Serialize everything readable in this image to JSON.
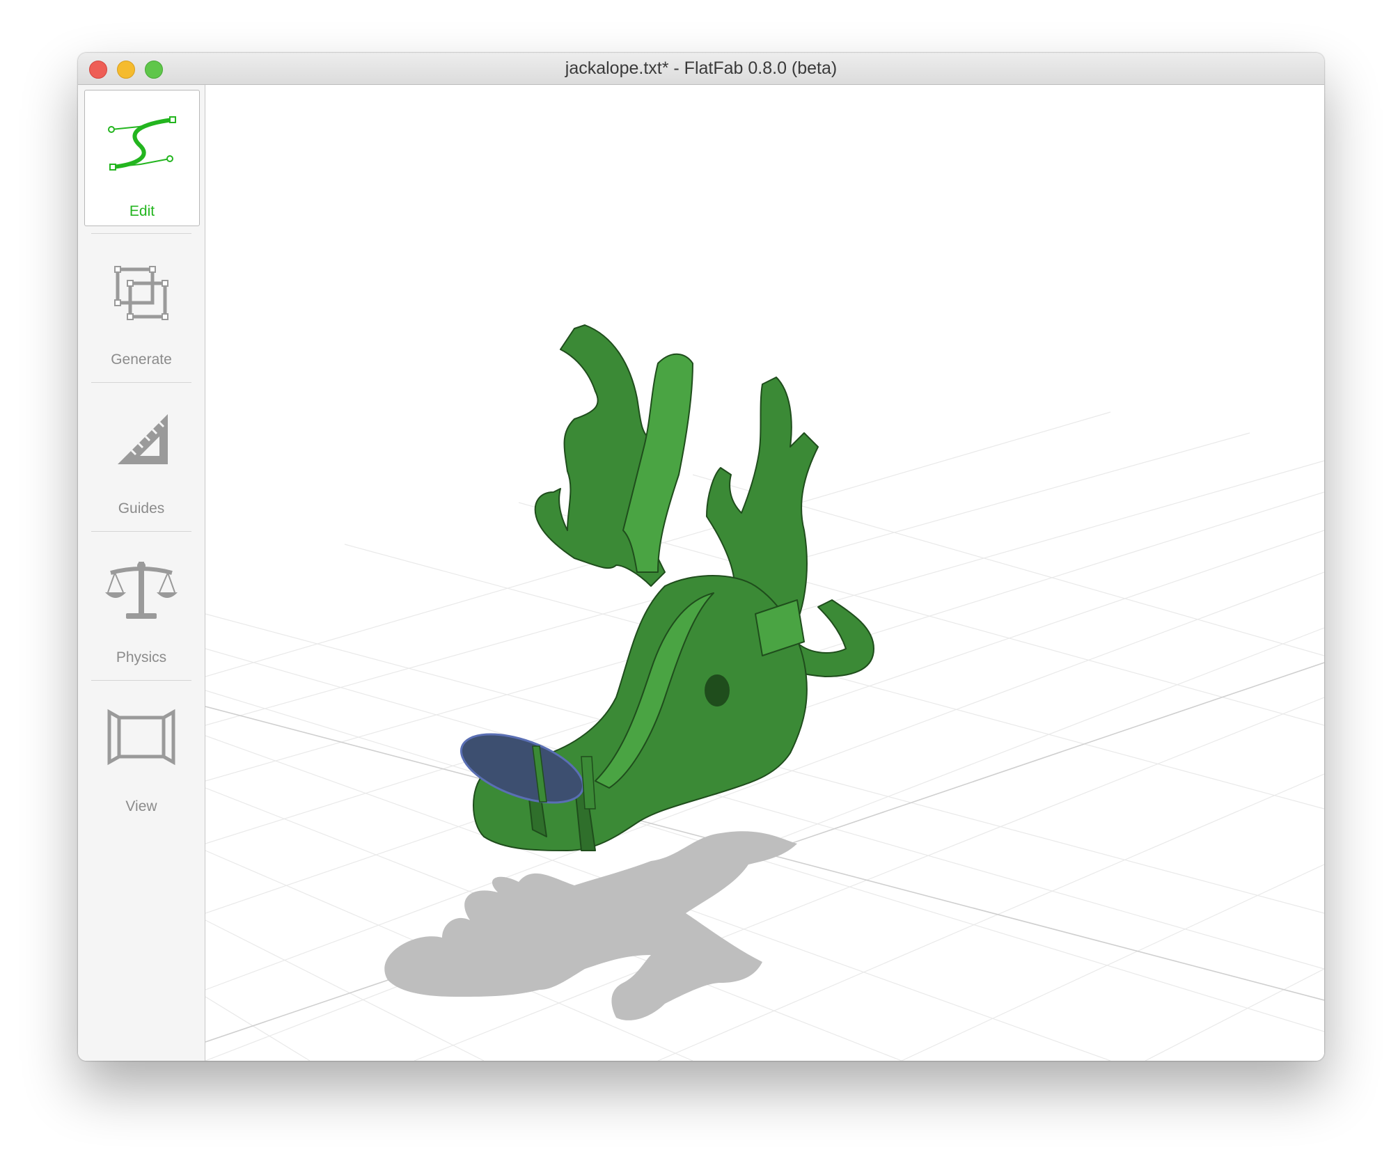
{
  "window": {
    "title": "jackalope.txt* - FlatFab 0.8.0 (beta)"
  },
  "sidebar": {
    "tools": [
      {
        "label": "Edit",
        "icon": "bezier-curve-icon",
        "active": true
      },
      {
        "label": "Generate",
        "icon": "overlapping-squares-icon",
        "active": false
      },
      {
        "label": "Guides",
        "icon": "set-square-ruler-icon",
        "active": false
      },
      {
        "label": "Physics",
        "icon": "balance-scale-icon",
        "active": false
      },
      {
        "label": "View",
        "icon": "view-frame-icon",
        "active": false
      }
    ]
  },
  "viewport": {
    "model_color": "#3b8a36",
    "model_highlight": "#4aa443",
    "model_edge": "#1f4d1c",
    "selected_part_color": "#3d4f70",
    "selected_part_edge": "#5a6fb4",
    "shadow_color": "#bebebe",
    "grid_color": "#e8e8e8"
  },
  "colors": {
    "accent_active": "#23b51f",
    "inactive_label": "#8b8b8b"
  }
}
